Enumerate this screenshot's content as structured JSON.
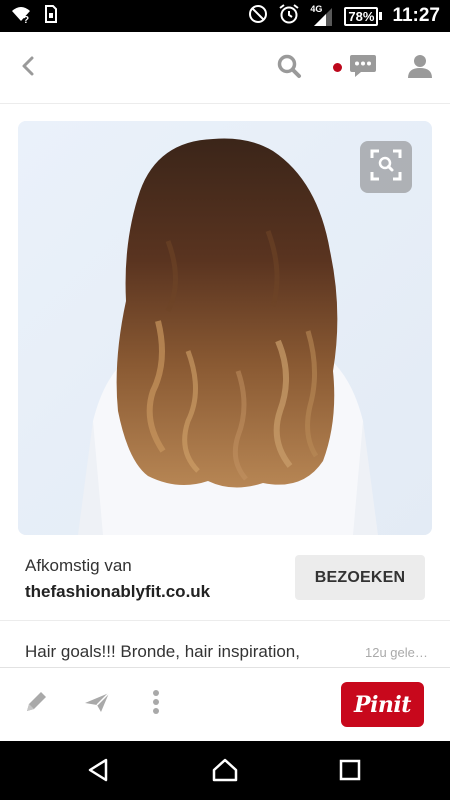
{
  "status_bar": {
    "network_type": "4G",
    "battery_percent": "78%",
    "time": "11:27",
    "icons": [
      "wifi-unknown-icon",
      "sim-icon",
      "do-not-disturb-icon",
      "alarm-icon",
      "signal-icon",
      "battery-icon"
    ]
  },
  "header": {
    "icons": [
      "back-icon",
      "search-icon",
      "notification-dot",
      "messages-icon",
      "profile-icon"
    ],
    "accent_color": "#bd081c"
  },
  "pin": {
    "image_description_icon": "visual-search-icon",
    "source_label": "Afkomstig van",
    "source_domain": "thefashionablyfit.co.uk",
    "visit_button": "BEZOEKEN",
    "description": "Hair goals!!! Bronde, hair inspiration,",
    "time_ago": "12u gele…"
  },
  "action_bar": {
    "icons": [
      "edit-pencil-icon",
      "send-icon",
      "more-options-icon"
    ],
    "pin_it_label": "Pinit",
    "pin_it_color": "#c8081c"
  },
  "nav_bar": {
    "icons": [
      "nav-back-icon",
      "nav-home-icon",
      "nav-recents-icon"
    ]
  }
}
